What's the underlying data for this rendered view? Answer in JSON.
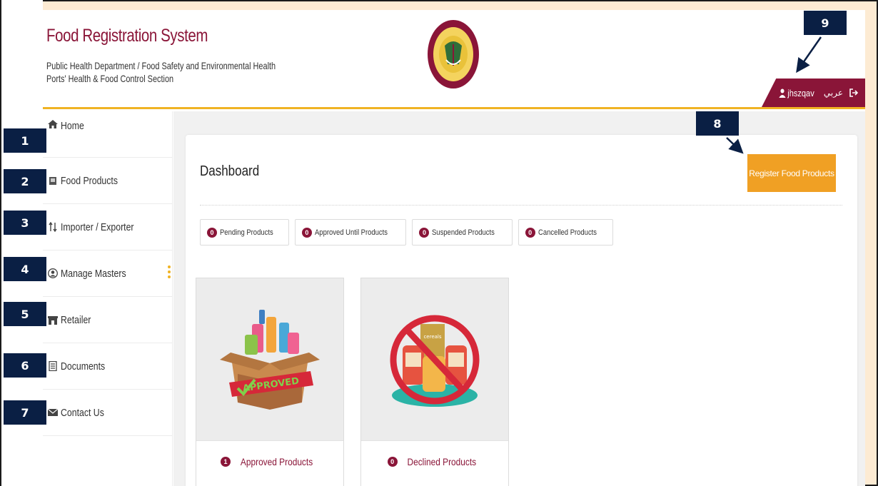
{
  "header": {
    "title": "Food Registration System",
    "subtitle_line1": "Public Health Department / Food Safety and Environmental Health",
    "subtitle_line2": "Ports' Health & Food Control Section",
    "logo_icon": "state-of-qatar-ministry-seal-icon",
    "user": {
      "username": "jhszqav",
      "language_label": "عربي",
      "user_icon": "user-icon",
      "logout_icon": "logout-icon"
    }
  },
  "sidebar": {
    "items": [
      {
        "label": "Home",
        "icon": "home-icon"
      },
      {
        "label": "Food Products",
        "icon": "food-products-icon"
      },
      {
        "label": "Importer / Exporter",
        "icon": "import-export-icon"
      },
      {
        "label": "Manage Masters",
        "icon": "manage-masters-icon"
      },
      {
        "label": "Retailer",
        "icon": "store-icon"
      },
      {
        "label": "Documents",
        "icon": "document-icon"
      },
      {
        "label": "Contact Us",
        "icon": "envelope-icon"
      }
    ]
  },
  "dashboard": {
    "title": "Dashboard",
    "register_button": "Register Food Products",
    "filters": [
      {
        "count": "0",
        "label": "Pending Products"
      },
      {
        "count": "0",
        "label": "Approved Until Products"
      },
      {
        "count": "0",
        "label": "Suspended Products"
      },
      {
        "count": "0",
        "label": "Cancelled Products"
      }
    ],
    "tiles": [
      {
        "count": "1",
        "label": "Approved Products",
        "image_icon": "approved-box-icon",
        "stamp": "APPROVED"
      },
      {
        "count": "0",
        "label": "Declined Products",
        "image_icon": "declined-cans-icon",
        "can_text": "cereals"
      }
    ]
  },
  "callouts": [
    "1",
    "2",
    "3",
    "4",
    "5",
    "6",
    "7",
    "8",
    "9"
  ],
  "colors": {
    "brand_maroon": "#8a1538",
    "accent_gold": "#f0b323",
    "register_orange": "#f0a024",
    "callout_navy": "#0a1f44",
    "frame_peach": "#fdebd3"
  }
}
